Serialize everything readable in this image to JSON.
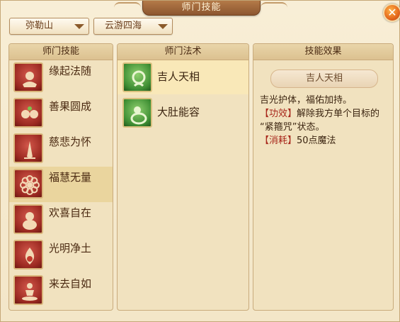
{
  "window": {
    "title": "师门技能"
  },
  "filters": {
    "mountain": "弥勒山",
    "world": "云游四海"
  },
  "panels": {
    "skills_header": "师门技能",
    "spells_header": "师门法术",
    "effect_header": "技能效果"
  },
  "skills": [
    {
      "label": "缘起法随",
      "icon": "monk-bowl-icon"
    },
    {
      "label": "善果圆成",
      "icon": "fruit-icon"
    },
    {
      "label": "慈悲为怀",
      "icon": "praying-hands-icon"
    },
    {
      "label": "福慧无量",
      "icon": "lotus-icon",
      "selected": true
    },
    {
      "label": "欢喜自在",
      "icon": "laughing-buddha-icon"
    },
    {
      "label": "光明净土",
      "icon": "flame-icon"
    },
    {
      "label": "来去自如",
      "icon": "meditating-icon"
    }
  ],
  "spells": [
    {
      "label": "吉人天相",
      "icon": "auspicious-icon",
      "selected": true
    },
    {
      "label": "大肚能容",
      "icon": "big-belly-icon"
    }
  ],
  "effect": {
    "name": "吉人天相",
    "line1": "吉光护体，福佑加持。",
    "effect_tag": "【功效】",
    "effect_text_a": "解除我方单个目标的",
    "effect_text_b": "“紧箍咒”状态。",
    "cost_tag": "【消耗】",
    "cost_text": "50点魔法"
  },
  "colors": {
    "skill_icon": "#9c2a22",
    "spell_icon": "#3f8f34",
    "selection": "#ead59e",
    "close": "#e4671c"
  }
}
